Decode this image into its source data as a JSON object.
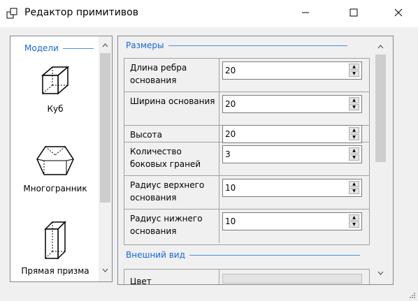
{
  "window": {
    "title": "Редактор примитивов",
    "icons": {
      "app": "window-icon",
      "minimize": "minimize-icon",
      "maximize": "maximize-icon",
      "close": "close-icon"
    }
  },
  "models_panel": {
    "header": "Модели",
    "items": [
      {
        "label": "Куб",
        "icon": "cube-icon"
      },
      {
        "label": "Многогранник",
        "icon": "polyhedron-icon"
      },
      {
        "label": "Прямая призма",
        "icon": "prism-icon"
      }
    ]
  },
  "properties": {
    "sections": [
      {
        "header": "Размеры",
        "rows": [
          {
            "label": "Длина ребра основания",
            "value": "20"
          },
          {
            "label": "Ширина основания",
            "value": "20"
          },
          {
            "label": "Высота",
            "value": "20"
          },
          {
            "label": "Количество боковых граней",
            "value": "3"
          },
          {
            "label": "Радиус верхнего основания",
            "value": "10"
          },
          {
            "label": "Радиус нижнего основания",
            "value": "10"
          }
        ]
      },
      {
        "header": "Внешний вид",
        "rows": [
          {
            "label": "Цвет",
            "value": ""
          }
        ]
      }
    ]
  },
  "colors": {
    "accent": "#1565d8",
    "border": "#828790",
    "grid": "#a0a0a0",
    "background": "#f0f0f0"
  }
}
